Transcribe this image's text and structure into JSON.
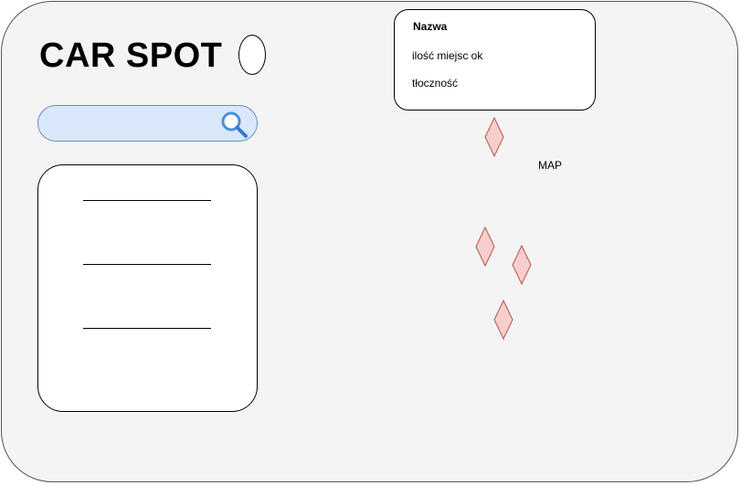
{
  "app": {
    "title": "CAR SPOT"
  },
  "search": {
    "value": "",
    "placeholder": "",
    "icon": "search-icon"
  },
  "list_panel": {
    "items": [
      "",
      "",
      ""
    ]
  },
  "info_card": {
    "name": "Nazwa",
    "spots": "ilość miejsc ok",
    "crowd": "tłoczność"
  },
  "map": {
    "label": "MAP",
    "marker_count": 4,
    "marker_fill": "#f8cecc",
    "marker_stroke": "#b85450"
  },
  "colors": {
    "background": "#f4f4f4",
    "search_fill": "#dae8fc",
    "search_stroke": "#6c8ebf",
    "icon_blue": "#4a90d9"
  }
}
